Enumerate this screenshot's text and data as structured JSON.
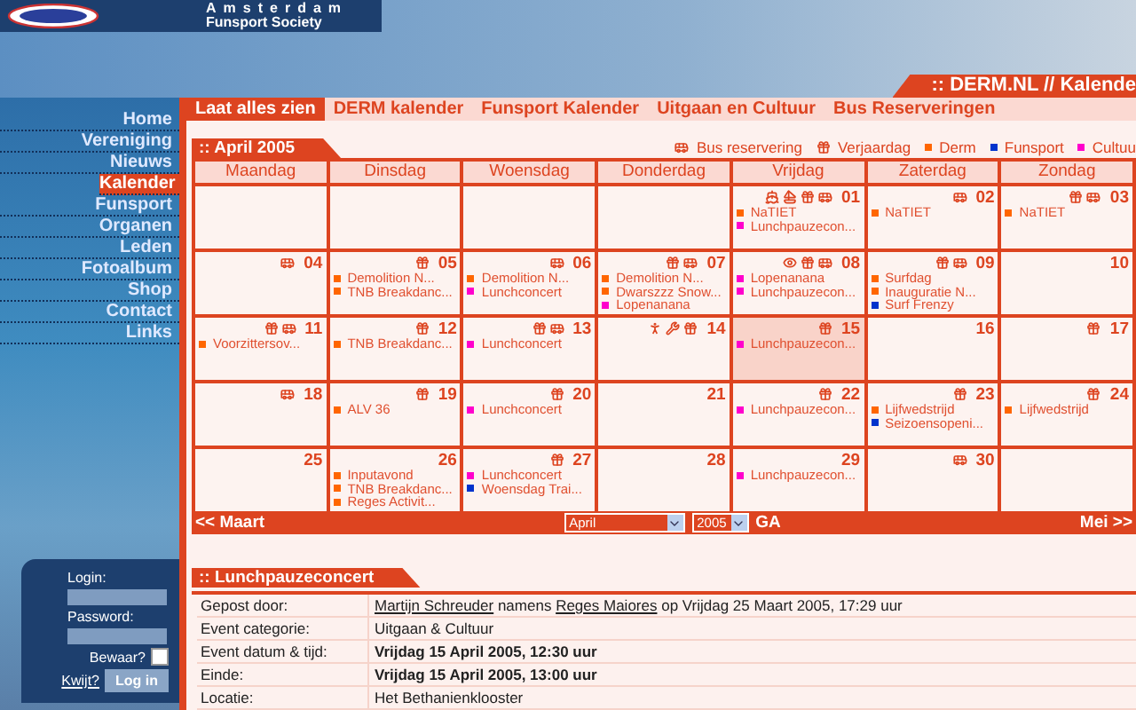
{
  "brand": {
    "title": "Amsterdam",
    "subtitle": "Funsport Society"
  },
  "page_title": ":: DERM.NL // Kalende",
  "nav": [
    {
      "label": "Home",
      "selected": false
    },
    {
      "label": "Vereniging",
      "selected": false
    },
    {
      "label": "Nieuws",
      "selected": false
    },
    {
      "label": "Kalender",
      "selected": true
    },
    {
      "label": "Funsport",
      "selected": false
    },
    {
      "label": "Organen",
      "selected": false
    },
    {
      "label": "Leden",
      "selected": false
    },
    {
      "label": "Fotoalbum",
      "selected": false
    },
    {
      "label": "Shop",
      "selected": false
    },
    {
      "label": "Contact",
      "selected": false
    },
    {
      "label": "Links",
      "selected": false
    }
  ],
  "login": {
    "login_label": "Login:",
    "password_label": "Password:",
    "remember_label": "Bewaar?",
    "remember_checked": false,
    "forgot_link": "Kwijt?",
    "button": "Log in"
  },
  "tabs": [
    {
      "label": "Laat alles zien",
      "selected": true
    },
    {
      "label": "DERM kalender",
      "selected": false
    },
    {
      "label": "Funsport Kalender",
      "selected": false
    },
    {
      "label": "Uitgaan en Cultuur",
      "selected": false
    },
    {
      "label": "Bus Reserveringen",
      "selected": false
    }
  ],
  "calendar": {
    "title": ":: April 2005",
    "legend": [
      {
        "kind": "bus",
        "label": "Bus reservering"
      },
      {
        "kind": "gift",
        "label": "Verjaardag"
      },
      {
        "kind": "color",
        "color": "#ff6600",
        "label": "Derm"
      },
      {
        "kind": "color",
        "color": "#0033cc",
        "label": "Funsport"
      },
      {
        "kind": "color",
        "color": "#ff00cc",
        "label": "Cultuu"
      }
    ],
    "weekdays": [
      "Maandag",
      "Dinsdag",
      "Woensdag",
      "Donderdag",
      "Vrijdag",
      "Zaterdag",
      "Zondag"
    ],
    "weeks": [
      {
        "days": [
          {
            "selected": false
          },
          {
            "selected": false
          },
          {
            "selected": false
          },
          {
            "selected": false
          },
          {
            "number": "01",
            "selected": false,
            "icons": [
              {
                "kind": "ship"
              },
              {
                "kind": "sailboat"
              },
              {
                "kind": "gift"
              },
              {
                "kind": "bus"
              }
            ],
            "events": [
              {
                "text": "NaTIET",
                "color": "#ff6600"
              },
              {
                "text": "Lunchpauzecon...",
                "color": "#ff00cc"
              }
            ]
          },
          {
            "number": "02",
            "selected": false,
            "icons": [
              {
                "kind": "bus"
              }
            ],
            "events": [
              {
                "text": "NaTIET",
                "color": "#ff6600"
              }
            ]
          },
          {
            "number": "03",
            "selected": false,
            "icons": [
              {
                "kind": "gift"
              },
              {
                "kind": "bus"
              }
            ],
            "events": [
              {
                "text": "NaTIET",
                "color": "#ff6600"
              }
            ]
          }
        ]
      },
      {
        "days": [
          {
            "number": "04",
            "selected": false,
            "icons": [
              {
                "kind": "bus"
              }
            ]
          },
          {
            "number": "05",
            "selected": false,
            "icons": [
              {
                "kind": "gift"
              }
            ],
            "events": [
              {
                "text": "Demolition N...",
                "color": "#ff6600"
              },
              {
                "text": "TNB Breakdanc...",
                "color": "#ff6600"
              }
            ]
          },
          {
            "number": "06",
            "selected": false,
            "icons": [
              {
                "kind": "bus"
              }
            ],
            "events": [
              {
                "text": "Demolition N...",
                "color": "#ff6600"
              },
              {
                "text": "Lunchconcert",
                "color": "#ff00cc"
              }
            ]
          },
          {
            "number": "07",
            "selected": false,
            "icons": [
              {
                "kind": "gift"
              },
              {
                "kind": "bus"
              }
            ],
            "events": [
              {
                "text": "Demolition N...",
                "color": "#ff6600"
              },
              {
                "text": "Dwarszzz Snow...",
                "color": "#ff6600"
              },
              {
                "text": "Lopenanana",
                "color": "#ff00cc"
              }
            ]
          },
          {
            "number": "08",
            "selected": false,
            "icons": [
              {
                "kind": "eye"
              },
              {
                "kind": "gift"
              },
              {
                "kind": "bus"
              }
            ],
            "events": [
              {
                "text": "Lopenanana",
                "color": "#ff00cc"
              },
              {
                "text": "Lunchpauzecon...",
                "color": "#ff00cc"
              }
            ]
          },
          {
            "number": "09",
            "selected": false,
            "icons": [
              {
                "kind": "gift"
              },
              {
                "kind": "bus"
              }
            ],
            "events": [
              {
                "text": "Surfdag",
                "color": "#ff6600"
              },
              {
                "text": "Inauguratie N...",
                "color": "#ff6600"
              },
              {
                "text": "Surf Frenzy",
                "color": "#0033cc"
              }
            ]
          },
          {
            "number": "10",
            "selected": false
          }
        ]
      },
      {
        "days": [
          {
            "number": "11",
            "selected": false,
            "icons": [
              {
                "kind": "gift"
              },
              {
                "kind": "bus"
              }
            ],
            "events": [
              {
                "text": "Voorzittersov...",
                "color": "#ff6600"
              }
            ]
          },
          {
            "number": "12",
            "selected": false,
            "icons": [
              {
                "kind": "gift"
              }
            ],
            "events": [
              {
                "text": "TNB Breakdanc...",
                "color": "#ff6600"
              }
            ]
          },
          {
            "number": "13",
            "selected": false,
            "icons": [
              {
                "kind": "gift"
              },
              {
                "kind": "bus"
              }
            ],
            "events": [
              {
                "text": "Lunchconcert",
                "color": "#ff00cc"
              }
            ]
          },
          {
            "number": "14",
            "selected": false,
            "icons": [
              {
                "kind": "person"
              },
              {
                "kind": "wrench"
              },
              {
                "kind": "gift"
              }
            ]
          },
          {
            "number": "15",
            "selected": true,
            "icons": [
              {
                "kind": "gift"
              }
            ],
            "events": [
              {
                "text": "Lunchpauzecon...",
                "color": "#ff00cc"
              }
            ]
          },
          {
            "number": "16",
            "selected": false
          },
          {
            "number": "17",
            "selected": false,
            "icons": [
              {
                "kind": "gift"
              }
            ]
          }
        ]
      },
      {
        "days": [
          {
            "number": "18",
            "selected": false,
            "icons": [
              {
                "kind": "bus"
              }
            ]
          },
          {
            "number": "19",
            "selected": false,
            "icons": [
              {
                "kind": "gift"
              }
            ],
            "events": [
              {
                "text": "ALV 36",
                "color": "#ff6600"
              }
            ]
          },
          {
            "number": "20",
            "selected": false,
            "icons": [
              {
                "kind": "gift"
              }
            ],
            "events": [
              {
                "text": "Lunchconcert",
                "color": "#ff00cc"
              }
            ]
          },
          {
            "number": "21",
            "selected": false
          },
          {
            "number": "22",
            "selected": false,
            "icons": [
              {
                "kind": "gift"
              }
            ],
            "events": [
              {
                "text": "Lunchpauzecon...",
                "color": "#ff00cc"
              }
            ]
          },
          {
            "number": "23",
            "selected": false,
            "icons": [
              {
                "kind": "gift"
              }
            ],
            "events": [
              {
                "text": "Lijfwedstrijd",
                "color": "#ff6600"
              },
              {
                "text": "Seizoensopeni...",
                "color": "#0033cc"
              }
            ]
          },
          {
            "number": "24",
            "selected": false,
            "icons": [
              {
                "kind": "gift"
              }
            ],
            "events": [
              {
                "text": "Lijfwedstrijd",
                "color": "#ff6600"
              }
            ]
          }
        ]
      },
      {
        "days": [
          {
            "number": "25",
            "selected": false
          },
          {
            "number": "26",
            "selected": false,
            "events": [
              {
                "text": "Inputavond",
                "color": "#ff6600"
              },
              {
                "text": "TNB Breakdanc...",
                "color": "#ff6600"
              },
              {
                "text": "Reges Activit...",
                "color": "#ff6600"
              }
            ]
          },
          {
            "number": "27",
            "selected": false,
            "icons": [
              {
                "kind": "gift"
              }
            ],
            "events": [
              {
                "text": "Lunchconcert",
                "color": "#ff00cc"
              },
              {
                "text": "Woensdag Trai...",
                "color": "#0033cc"
              }
            ]
          },
          {
            "number": "28",
            "selected": false
          },
          {
            "number": "29",
            "selected": false,
            "events": [
              {
                "text": "Lunchpauzecon...",
                "color": "#ff00cc"
              }
            ]
          },
          {
            "number": "30",
            "selected": false,
            "icons": [
              {
                "kind": "bus"
              }
            ]
          },
          {
            "selected": false
          }
        ]
      }
    ],
    "prev": "<< Maart",
    "month": "April",
    "year": "2005",
    "go": "GA",
    "next": "Mei >>"
  },
  "event": {
    "title": ":: Lunchpauzeconcert",
    "rows": [
      {
        "label": "Gepost door:",
        "bold": false,
        "parts": [
          {
            "text": "Martijn Schreuder",
            "kind": "link"
          },
          {
            "text": " namens ",
            "kind": "text"
          },
          {
            "text": "Reges Maiores",
            "kind": "link"
          },
          {
            "text": " op Vrijdag 25 Maart 2005, 17:29 uur",
            "kind": "text"
          }
        ]
      },
      {
        "label": "Event categorie:",
        "bold": false,
        "parts": [
          {
            "text": "Uitgaan & Cultuur",
            "kind": "text"
          }
        ]
      },
      {
        "label": "Event datum & tijd:",
        "bold": true,
        "parts": [
          {
            "text": "Vrijdag 15 April 2005, 12:30 uur",
            "kind": "text"
          }
        ]
      },
      {
        "label": "Einde:",
        "bold": true,
        "parts": [
          {
            "text": "Vrijdag 15 April 2005, 13:00 uur",
            "kind": "text"
          }
        ]
      },
      {
        "label": "Locatie:",
        "bold": false,
        "parts": [
          {
            "text": "Het Bethanienklooster",
            "kind": "text"
          }
        ]
      }
    ]
  }
}
